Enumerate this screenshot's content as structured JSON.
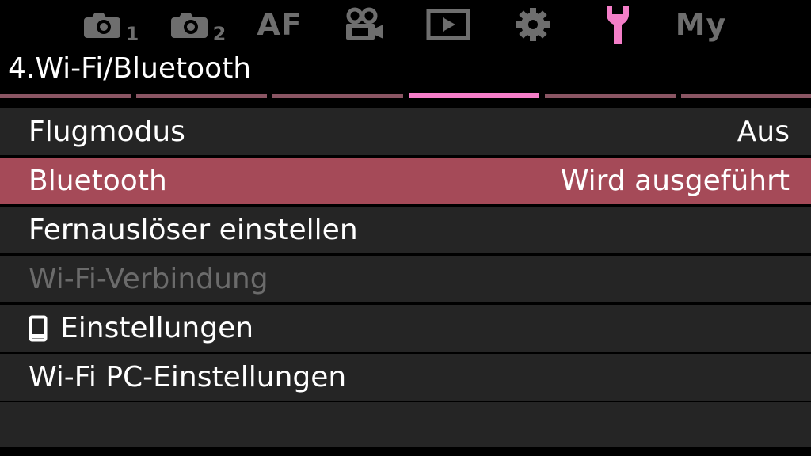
{
  "tabs": [
    {
      "name": "shooting-menu-1",
      "icon": "camera-icon",
      "sub": "1"
    },
    {
      "name": "shooting-menu-2",
      "icon": "camera-icon",
      "sub": "2"
    },
    {
      "name": "af-menu",
      "label": "AF"
    },
    {
      "name": "video-menu",
      "icon": "movie-camera-icon"
    },
    {
      "name": "playback-menu",
      "icon": "play-icon"
    },
    {
      "name": "custom-menu",
      "icon": "gear-icon"
    },
    {
      "name": "setup-menu",
      "icon": "wrench-icon",
      "active": true
    },
    {
      "name": "my-menu",
      "label": "My"
    }
  ],
  "colors": {
    "active_tab": "#f47ec8",
    "inactive_tab": "#6e6e6e",
    "selected_row": "#a54a58",
    "row_bg": "#252525",
    "disabled_text": "#6b6b6b"
  },
  "page": {
    "title": "4.Wi-Fi/Bluetooth",
    "page_count": 6,
    "active_page": 4
  },
  "menu": {
    "items": [
      {
        "label": "Flugmodus",
        "value": "Aus"
      },
      {
        "label": "Bluetooth",
        "value": "Wird ausgeführt",
        "selected": true
      },
      {
        "label": "Fernauslöser einstellen",
        "value": ""
      },
      {
        "label": "Wi-Fi-Verbindung",
        "value": "",
        "disabled": true
      },
      {
        "label": "Einstellungen",
        "value": "",
        "icon": "smartphone-icon"
      },
      {
        "label": "Wi-Fi PC-Einstellungen",
        "value": ""
      }
    ]
  }
}
